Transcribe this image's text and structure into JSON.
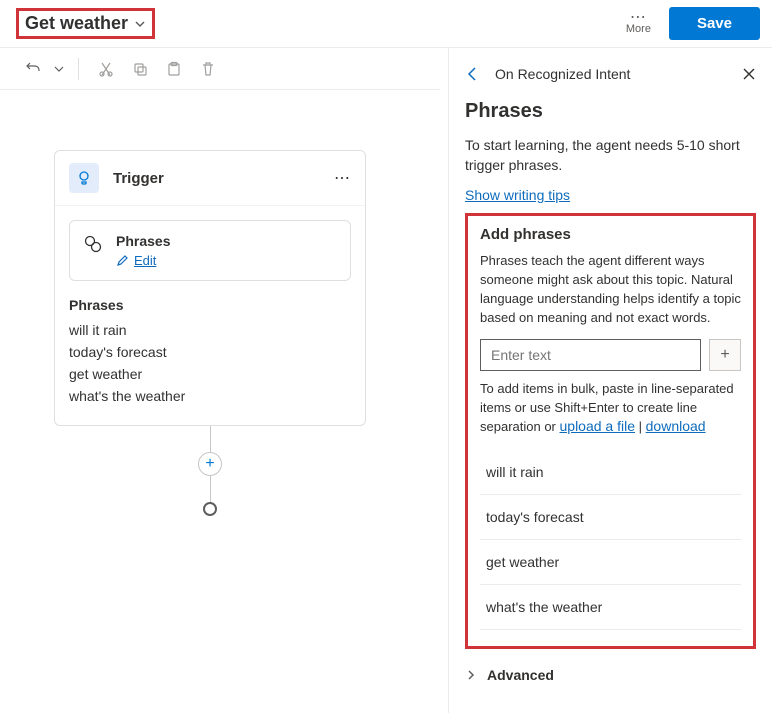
{
  "header": {
    "title": "Get weather",
    "more_label": "More",
    "save_label": "Save"
  },
  "canvas": {
    "trigger_label": "Trigger",
    "phrases_header": "Phrases",
    "edit_label": "Edit",
    "phrases_list_title": "Phrases",
    "phrases": [
      "will it rain",
      "today's forecast",
      "get weather",
      "what's the weather"
    ]
  },
  "panel": {
    "back_title": "On Recognized Intent",
    "section_title": "Phrases",
    "description": "To start learning, the agent needs 5-10 short trigger phrases.",
    "tips_link": "Show writing tips",
    "add": {
      "title": "Add phrases",
      "desc": "Phrases teach the agent different ways someone might ask about this topic. Natural language understanding helps identify a topic based on meaning and not exact words.",
      "placeholder": "Enter text",
      "bulk_prefix": "To add items in bulk, paste in line-separated items or use Shift+Enter to create line separation or ",
      "upload_link": "upload a file",
      "download_link": "download",
      "items": [
        "will it rain",
        "today's forecast",
        "get weather",
        "what's the weather"
      ]
    },
    "advanced_label": "Advanced"
  }
}
